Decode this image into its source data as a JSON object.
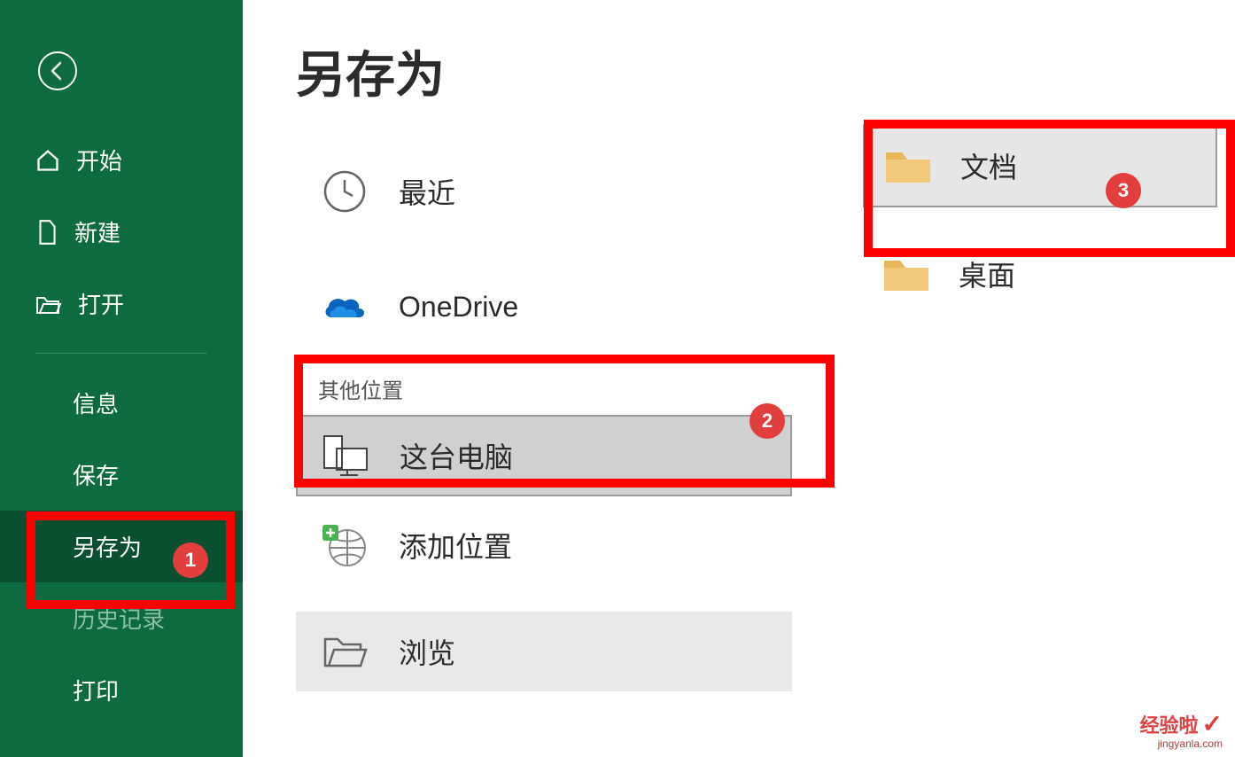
{
  "sidebar": {
    "items": [
      {
        "label": "开始"
      },
      {
        "label": "新建"
      },
      {
        "label": "打开"
      },
      {
        "label": "信息"
      },
      {
        "label": "保存"
      },
      {
        "label": "另存为"
      },
      {
        "label": "历史记录"
      },
      {
        "label": "打印"
      }
    ]
  },
  "main": {
    "title": "另存为",
    "locations": {
      "recent": "最近",
      "onedrive": "OneDrive",
      "other_section": "其他位置",
      "this_pc": "这台电脑",
      "add_location": "添加位置",
      "browse": "浏览"
    },
    "folders": {
      "documents": "文档",
      "desktop": "桌面"
    }
  },
  "badges": {
    "b1": "1",
    "b2": "2",
    "b3": "3"
  },
  "watermark": {
    "main": "经验啦",
    "sub": "jingyanla.com"
  }
}
